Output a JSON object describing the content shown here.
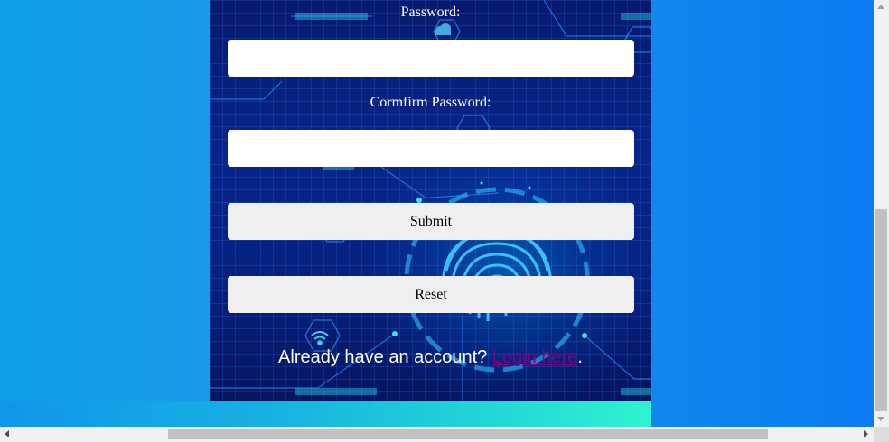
{
  "form": {
    "password_label": "Password:",
    "password_value": "",
    "confirm_label": "Cormfirm Password:",
    "confirm_value": "",
    "submit_label": "Submit",
    "reset_label": "Reset",
    "already_text": "Already have an account? ",
    "login_link": "Login here",
    "after_link": "."
  },
  "colors": {
    "panel": "#061a6e",
    "accent": "#25c3f2",
    "link": "#800080",
    "button_bg": "#efefef"
  },
  "icons": [
    "fingerprint-icon",
    "wifi-icon",
    "cloud-download-icon"
  ]
}
